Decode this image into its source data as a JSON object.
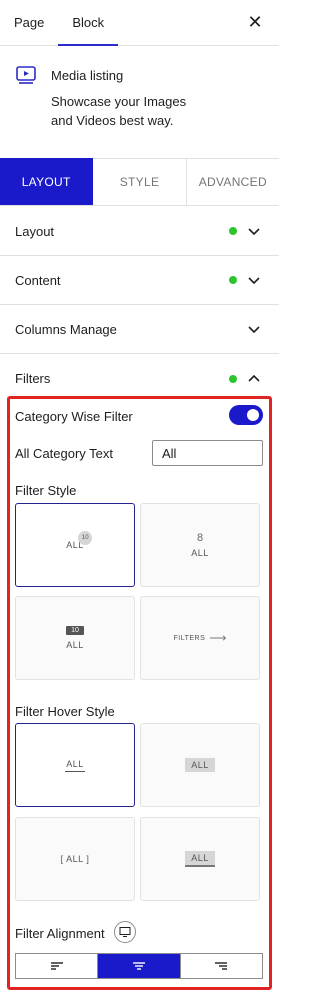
{
  "sidebar_tabs": {
    "page": "Page",
    "block": "Block",
    "close": "✕"
  },
  "block": {
    "icon": "media-icon",
    "title": "Media listing",
    "description": "Showcase your Images and Videos best way."
  },
  "settings_tabs": {
    "layout": "LAYOUT",
    "style": "STYLE",
    "advanced": "ADVANCED"
  },
  "panels": {
    "layout": "Layout",
    "content": "Content",
    "columns": "Columns Manage",
    "filters": "Filters"
  },
  "filters": {
    "category_wise_filter_label": "Category Wise Filter",
    "category_wise_filter_enabled": true,
    "all_category_text_label": "All Category Text",
    "all_category_text_value": "All",
    "filter_style_label": "Filter Style",
    "filter_styles": [
      {
        "label": "ALL",
        "count": "10"
      },
      {
        "label": "ALL",
        "count": "8"
      },
      {
        "label": "ALL",
        "count": "10"
      },
      {
        "label": "FILTERS",
        "arrow": "⟶"
      }
    ],
    "filter_hover_style_label": "Filter Hover Style",
    "hover_styles": [
      {
        "label": "ALL"
      },
      {
        "label": "ALL"
      },
      {
        "label": "[ ALL ]"
      },
      {
        "label": "ALL"
      }
    ],
    "filter_alignment_label": "Filter Alignment",
    "alignment_selected": "center"
  },
  "colors": {
    "accent": "#1a1acb",
    "status_dot": "#2cc52c",
    "highlight_border": "#e02424"
  }
}
